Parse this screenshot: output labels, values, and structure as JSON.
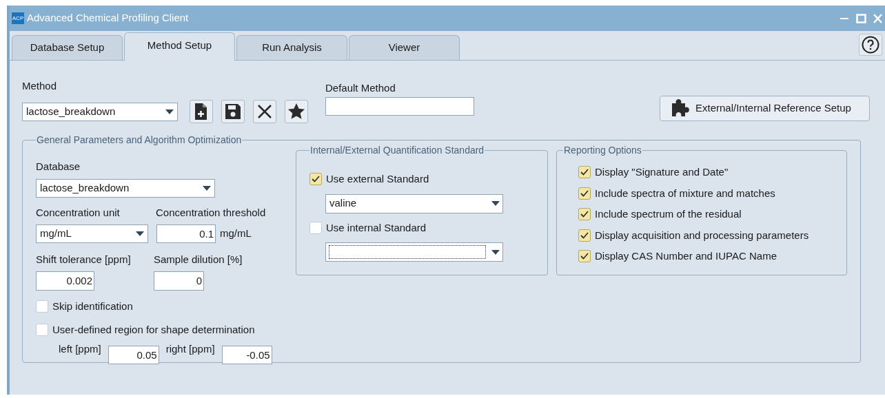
{
  "window": {
    "title": "Advanced Chemical Profiling Client",
    "logo": "ACP"
  },
  "tabs": [
    {
      "label": "Database Setup",
      "selected": false
    },
    {
      "label": "Method Setup",
      "selected": true
    },
    {
      "label": "Run Analysis",
      "selected": false
    },
    {
      "label": "Viewer",
      "selected": false
    }
  ],
  "method": {
    "label": "Method",
    "value": "lactose_breakdown",
    "toolbar": [
      {
        "kind": "new"
      },
      {
        "kind": "save"
      },
      {
        "kind": "delete"
      },
      {
        "kind": "default"
      }
    ]
  },
  "default_method": {
    "label": "Default Method"
  },
  "reference_button": {
    "label": "External/Internal Reference Setup"
  },
  "general": {
    "title": "General Parameters and Algorithm Optimization",
    "database": {
      "label": "Database",
      "value": "lactose_breakdown"
    },
    "concentration_unit": {
      "label": "Concentration unit",
      "value": "mg/mL"
    },
    "concentration_threshold": {
      "label": "Concentration threshold",
      "value": "0.1",
      "unit": "mg/mL"
    },
    "shift_tolerance": {
      "label": "Shift tolerance [ppm]",
      "value": "0.002"
    },
    "sample_dilution": {
      "label": "Sample dilution [%]",
      "value": "0"
    },
    "checks": [
      {
        "label": "Skip identification",
        "checked": false
      },
      {
        "label": "User-defined region for shape determination",
        "checked": false
      }
    ],
    "region": {
      "left_label": "left [ppm]",
      "left_value": "0.05",
      "right_label": "right [ppm]",
      "right_value": "-0.05"
    }
  },
  "quantification": {
    "title": "Internal/External Quantification Standard",
    "options": [
      {
        "label": "Use external Standard",
        "checked": true,
        "dropdown": {
          "value": "valine",
          "focused": false
        }
      },
      {
        "label": "Use internal Standard",
        "checked": false,
        "dropdown": {
          "focused": true
        }
      }
    ]
  },
  "reporting": {
    "title": "Reporting Options",
    "options": [
      {
        "label": "Display \"Signature and Date\"",
        "checked": true
      },
      {
        "label": "Include spectra of mixture and matches",
        "checked": true
      },
      {
        "label": "Include spectrum of the residual",
        "checked": true
      },
      {
        "label": "Display acquisition and processing parameters",
        "checked": true
      },
      {
        "label": "Display CAS Number and IUPAC Name",
        "checked": true
      }
    ]
  }
}
